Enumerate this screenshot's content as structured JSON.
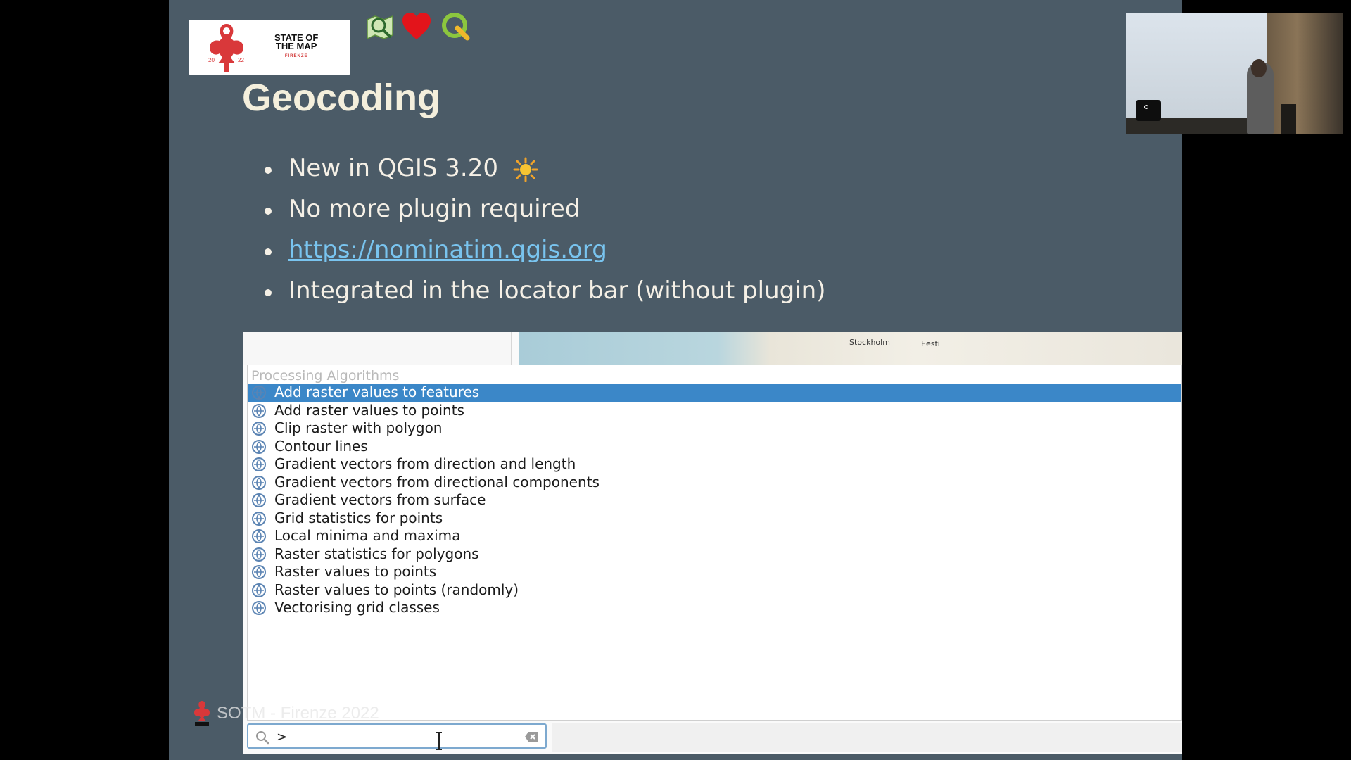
{
  "slide": {
    "logo": {
      "event_name_line1": "STATE OF",
      "event_name_line2": "THE MAP",
      "city": "FIRENZE",
      "year_left": "20",
      "year_right": "22"
    },
    "top_icons": [
      "map-search-icon",
      "heart-icon",
      "qgis-icon"
    ],
    "title": "Geocoding",
    "bullets": [
      {
        "text": "New in QGIS 3.20",
        "icon": "sun-icon"
      },
      {
        "text": "No more plugin required"
      },
      {
        "text": "https://nominatim.qgis.org",
        "is_link": true
      },
      {
        "text": "Integrated in the locator bar (without plugin)"
      }
    ],
    "footer": "SOTM - Firenze 2022",
    "colors": {
      "slide_bg": "#4b5b67",
      "title": "#f4efdc",
      "link": "#79c4ef",
      "selection": "#3b87c8"
    }
  },
  "qgis": {
    "map_labels": {
      "stockholm": "Stockholm",
      "eesti": "Eesti"
    },
    "results_header": "Processing Algorithms",
    "results": [
      {
        "label": "Add raster values to features",
        "selected": true
      },
      {
        "label": "Add raster values to points"
      },
      {
        "label": "Clip raster with polygon"
      },
      {
        "label": "Contour lines"
      },
      {
        "label": "Gradient vectors from direction and length"
      },
      {
        "label": "Gradient vectors from directional components"
      },
      {
        "label": "Gradient vectors from surface"
      },
      {
        "label": "Grid statistics for points"
      },
      {
        "label": "Local minima and maxima"
      },
      {
        "label": "Raster statistics for polygons"
      },
      {
        "label": "Raster values to points"
      },
      {
        "label": "Raster values to points (randomly)"
      },
      {
        "label": "Vectorising grid classes"
      }
    ],
    "locator": {
      "value": ">"
    }
  }
}
